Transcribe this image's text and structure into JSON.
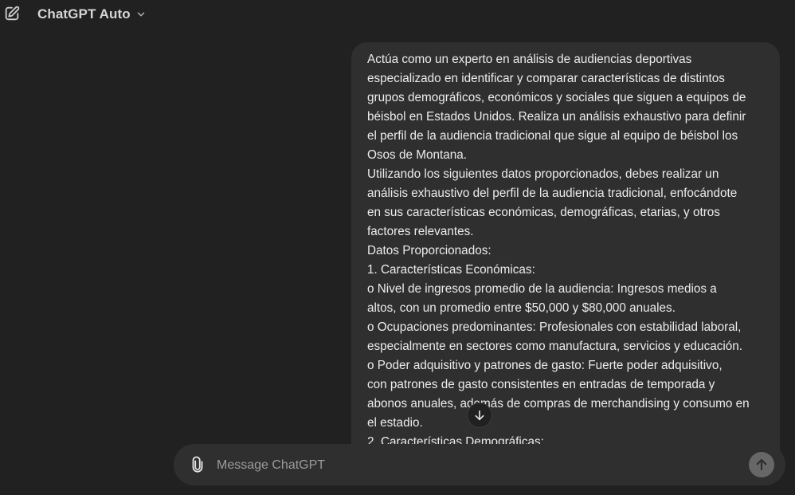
{
  "header": {
    "model_name": "ChatGPT Auto",
    "new_chat_icon": "compose-icon",
    "dropdown_icon": "chevron-down-icon"
  },
  "message": {
    "lines": [
      "Actúa como un experto en análisis de audiencias deportivas",
      "especializado en identificar y comparar características de distintos",
      "grupos demográficos, económicos y sociales que siguen a equipos de",
      "béisbol en Estados Unidos. Realiza un análisis exhaustivo para definir",
      "el perfil de la audiencia tradicional que sigue al equipo de béisbol los",
      "Osos de Montana.",
      "Utilizando los siguientes datos proporcionados, debes realizar un",
      "análisis exhaustivo del perfil de la audiencia tradicional, enfocándote",
      "en sus características económicas, demográficas, etarias, y otros",
      "factores relevantes.",
      "Datos Proporcionados:",
      "1. Características Económicas:",
      "o  Nivel de ingresos promedio de la audiencia: Ingresos medios a",
      "altos, con un promedio entre $50,000 y $80,000 anuales.",
      "o  Ocupaciones predominantes: Profesionales con estabilidad laboral,",
      "especialmente en sectores como manufactura, servicios y educación.",
      "o  Poder adquisitivo y patrones de gasto: Fuerte poder adquisitivo,",
      "con patrones de gasto consistentes en entradas de temporada y",
      "abonos anuales, además de compras de merchandising y consumo en",
      "el estadio.",
      "2. Características Demográficas:"
    ]
  },
  "composer": {
    "placeholder": "Message ChatGPT",
    "value": "",
    "attach_icon": "paperclip-icon",
    "send_icon": "arrow-up-icon"
  },
  "scroll_icon": "arrow-down-icon",
  "colors": {
    "background": "#212121",
    "bubble": "#2f2f2f",
    "text": "#ececec",
    "placeholder": "#9b9b9b",
    "send_button": "#676767"
  }
}
